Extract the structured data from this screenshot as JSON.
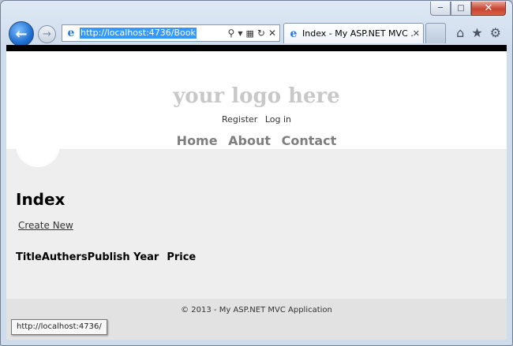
{
  "browser": {
    "address": {
      "url": "http://localhost:4736/Book"
    },
    "tab": {
      "title": "Index - My ASP.NET MVC ..."
    },
    "status_url": "http://localhost:4736/",
    "icons": {
      "back": "back-arrow-icon",
      "forward": "forward-arrow-icon",
      "search": "search-icon",
      "compat": "compatibility-view-icon",
      "refresh": "refresh-icon",
      "stop": "stop-icon",
      "home": "home-icon",
      "favorites": "star-icon",
      "tools": "gear-icon"
    },
    "colors": {
      "back_button": "#1f6fd1",
      "close_button": "#c7452f",
      "url_highlight": "#3399ff"
    }
  },
  "site": {
    "logo": "your logo here",
    "login_links": [
      "Register",
      "Log in"
    ],
    "menu": [
      "Home",
      "About",
      "Contact"
    ],
    "page_title": "Index",
    "create_link": "Create New",
    "table_headers": [
      "Title",
      "Authers",
      "Publish Year",
      "Price"
    ],
    "footer": "© 2013 - My ASP.NET MVC Application",
    "colors": {
      "logo": "#c8c8c8",
      "menu": "#7e7e7e",
      "content_bg": "#efeeef",
      "footer_bg": "#e2e2e2"
    }
  }
}
